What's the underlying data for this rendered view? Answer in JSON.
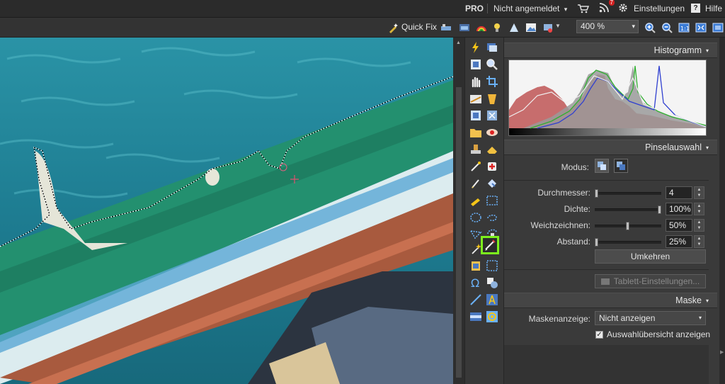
{
  "topbar": {
    "pro": "PRO",
    "login": "Nicht angemeldet",
    "login_caret": "▾",
    "rss_badge": "7",
    "settings": "Einstellungen",
    "help_glyph": "?",
    "help": "Hilfe"
  },
  "toolbar": {
    "quick_fix": "Quick Fix",
    "zoom_value": "400 %",
    "zoom_caret": "▾"
  },
  "panel": {
    "histogram": {
      "title": "Histogramm",
      "caret": "▾"
    },
    "brush": {
      "title": "Pinselauswahl",
      "caret": "▾",
      "mode_label": "Modus:",
      "rows": [
        {
          "label": "Durchmesser:",
          "value": "4",
          "level": 0.02
        },
        {
          "label": "Dichte:",
          "value": "100%",
          "level": 1.0
        },
        {
          "label": "Weichzeichnen:",
          "value": "50%",
          "level": 0.5
        },
        {
          "label": "Abstand:",
          "value": "25%",
          "level": 0.02
        }
      ],
      "invert_button": "Umkehren",
      "tablet_button": "Tablett-Einstellungen..."
    },
    "mask": {
      "title": "Maske",
      "caret": "▾",
      "display_label": "Maskenanzeige:",
      "display_value": "Nicht anzeigen",
      "display_caret": "▾",
      "overview_label": "Auswahlübersicht anzeigen",
      "overview_checked": true,
      "check_glyph": "✓"
    }
  },
  "colors": {
    "active_tool_border": "#7cf01d",
    "histogram_red": "#d03030",
    "histogram_green": "#30b030",
    "histogram_blue": "#3040d0"
  }
}
